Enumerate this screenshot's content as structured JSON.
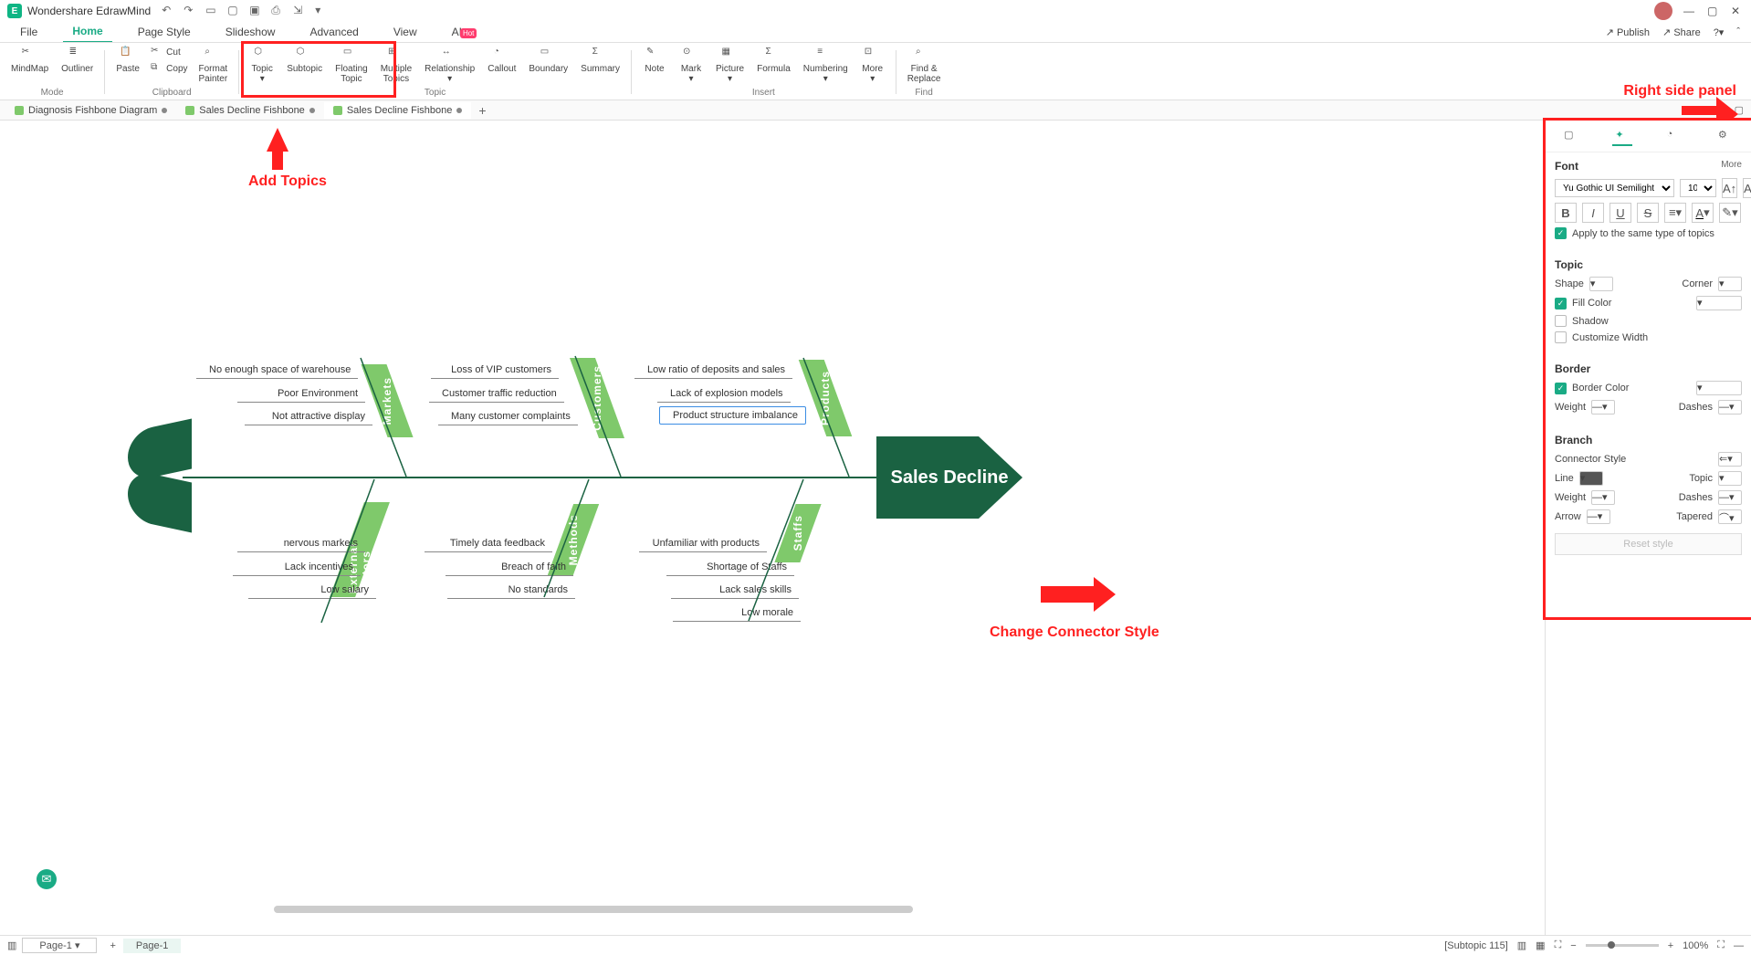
{
  "app": {
    "title": "Wondershare EdrawMind"
  },
  "menu": {
    "tabs": [
      "File",
      "Home",
      "Page Style",
      "Slideshow",
      "Advanced",
      "View",
      "AI"
    ],
    "active": 1,
    "hot": "Hot",
    "right": {
      "publish": "Publish",
      "share": "Share"
    }
  },
  "ribbon": {
    "mode": {
      "mindmap": "MindMap",
      "outliner": "Outliner",
      "label": "Mode"
    },
    "clipboard": {
      "paste": "Paste",
      "cut": "Cut",
      "copy": "Copy",
      "painter": "Format\nPainter",
      "label": "Clipboard"
    },
    "topic": {
      "topic": "Topic",
      "subtopic": "Subtopic",
      "floating": "Floating\nTopic",
      "multiple": "Multiple\nTopics",
      "relationship": "Relationship",
      "callout": "Callout",
      "boundary": "Boundary",
      "summary": "Summary",
      "label": "Topic"
    },
    "insert": {
      "note": "Note",
      "mark": "Mark",
      "picture": "Picture",
      "formula": "Formula",
      "numbering": "Numbering",
      "more": "More",
      "label": "Insert"
    },
    "find": {
      "findreplace": "Find &\nReplace",
      "label": "Find"
    }
  },
  "doctabs": {
    "tabs": [
      {
        "name": "Diagnosis Fishbone Diagram"
      },
      {
        "name": "Sales Decline Fishbone"
      },
      {
        "name": "Sales Decline Fishbone"
      }
    ],
    "active": 2
  },
  "fishbone": {
    "head": "Sales Decline",
    "bones": {
      "markets": {
        "label": "Markets",
        "items": [
          "No enough space of warehouse",
          "Poor Environment",
          "Not attractive display"
        ]
      },
      "customers": {
        "label": "Customers",
        "items": [
          "Loss of VIP customers",
          "Customer traffic reduction",
          "Many customer complaints"
        ]
      },
      "products": {
        "label": "Products",
        "items": [
          "Low ratio of deposits and sales",
          "Lack of explosion models",
          "Product structure imbalance"
        ]
      },
      "external": {
        "label": "External factors",
        "items": [
          "nervous markets",
          "Lack incentives",
          "Low salary"
        ]
      },
      "methods": {
        "label": "Methods",
        "items": [
          "Timely data feedback",
          "Breach of faith",
          "No standards"
        ]
      },
      "staffs": {
        "label": "Staffs",
        "items": [
          "Unfamiliar with products",
          "Shortage of Staffs",
          "Lack sales skills",
          "Low morale"
        ]
      }
    }
  },
  "annotations": {
    "add_topics": "Add Topics",
    "right_panel": "Right side panel",
    "connector": "Change Connector Style"
  },
  "panel": {
    "font": {
      "title": "Font",
      "more": "More",
      "family": "Yu Gothic UI Semilight",
      "size": "10",
      "apply": "Apply to the same type of topics"
    },
    "topic": {
      "title": "Topic",
      "shape": "Shape",
      "corner": "Corner",
      "fill": "Fill Color",
      "shadow": "Shadow",
      "custom": "Customize Width"
    },
    "border": {
      "title": "Border",
      "color": "Border Color",
      "weight": "Weight",
      "dashes": "Dashes"
    },
    "branch": {
      "title": "Branch",
      "connector": "Connector Style",
      "line": "Line",
      "topic": "Topic",
      "weight": "Weight",
      "dashes": "Dashes",
      "arrow": "Arrow",
      "tapered": "Tapered",
      "reset": "Reset style"
    }
  },
  "status": {
    "page_label": "Page-1",
    "page_tab": "Page-1",
    "subtopic": "[Subtopic 115]",
    "zoom": "100%"
  }
}
